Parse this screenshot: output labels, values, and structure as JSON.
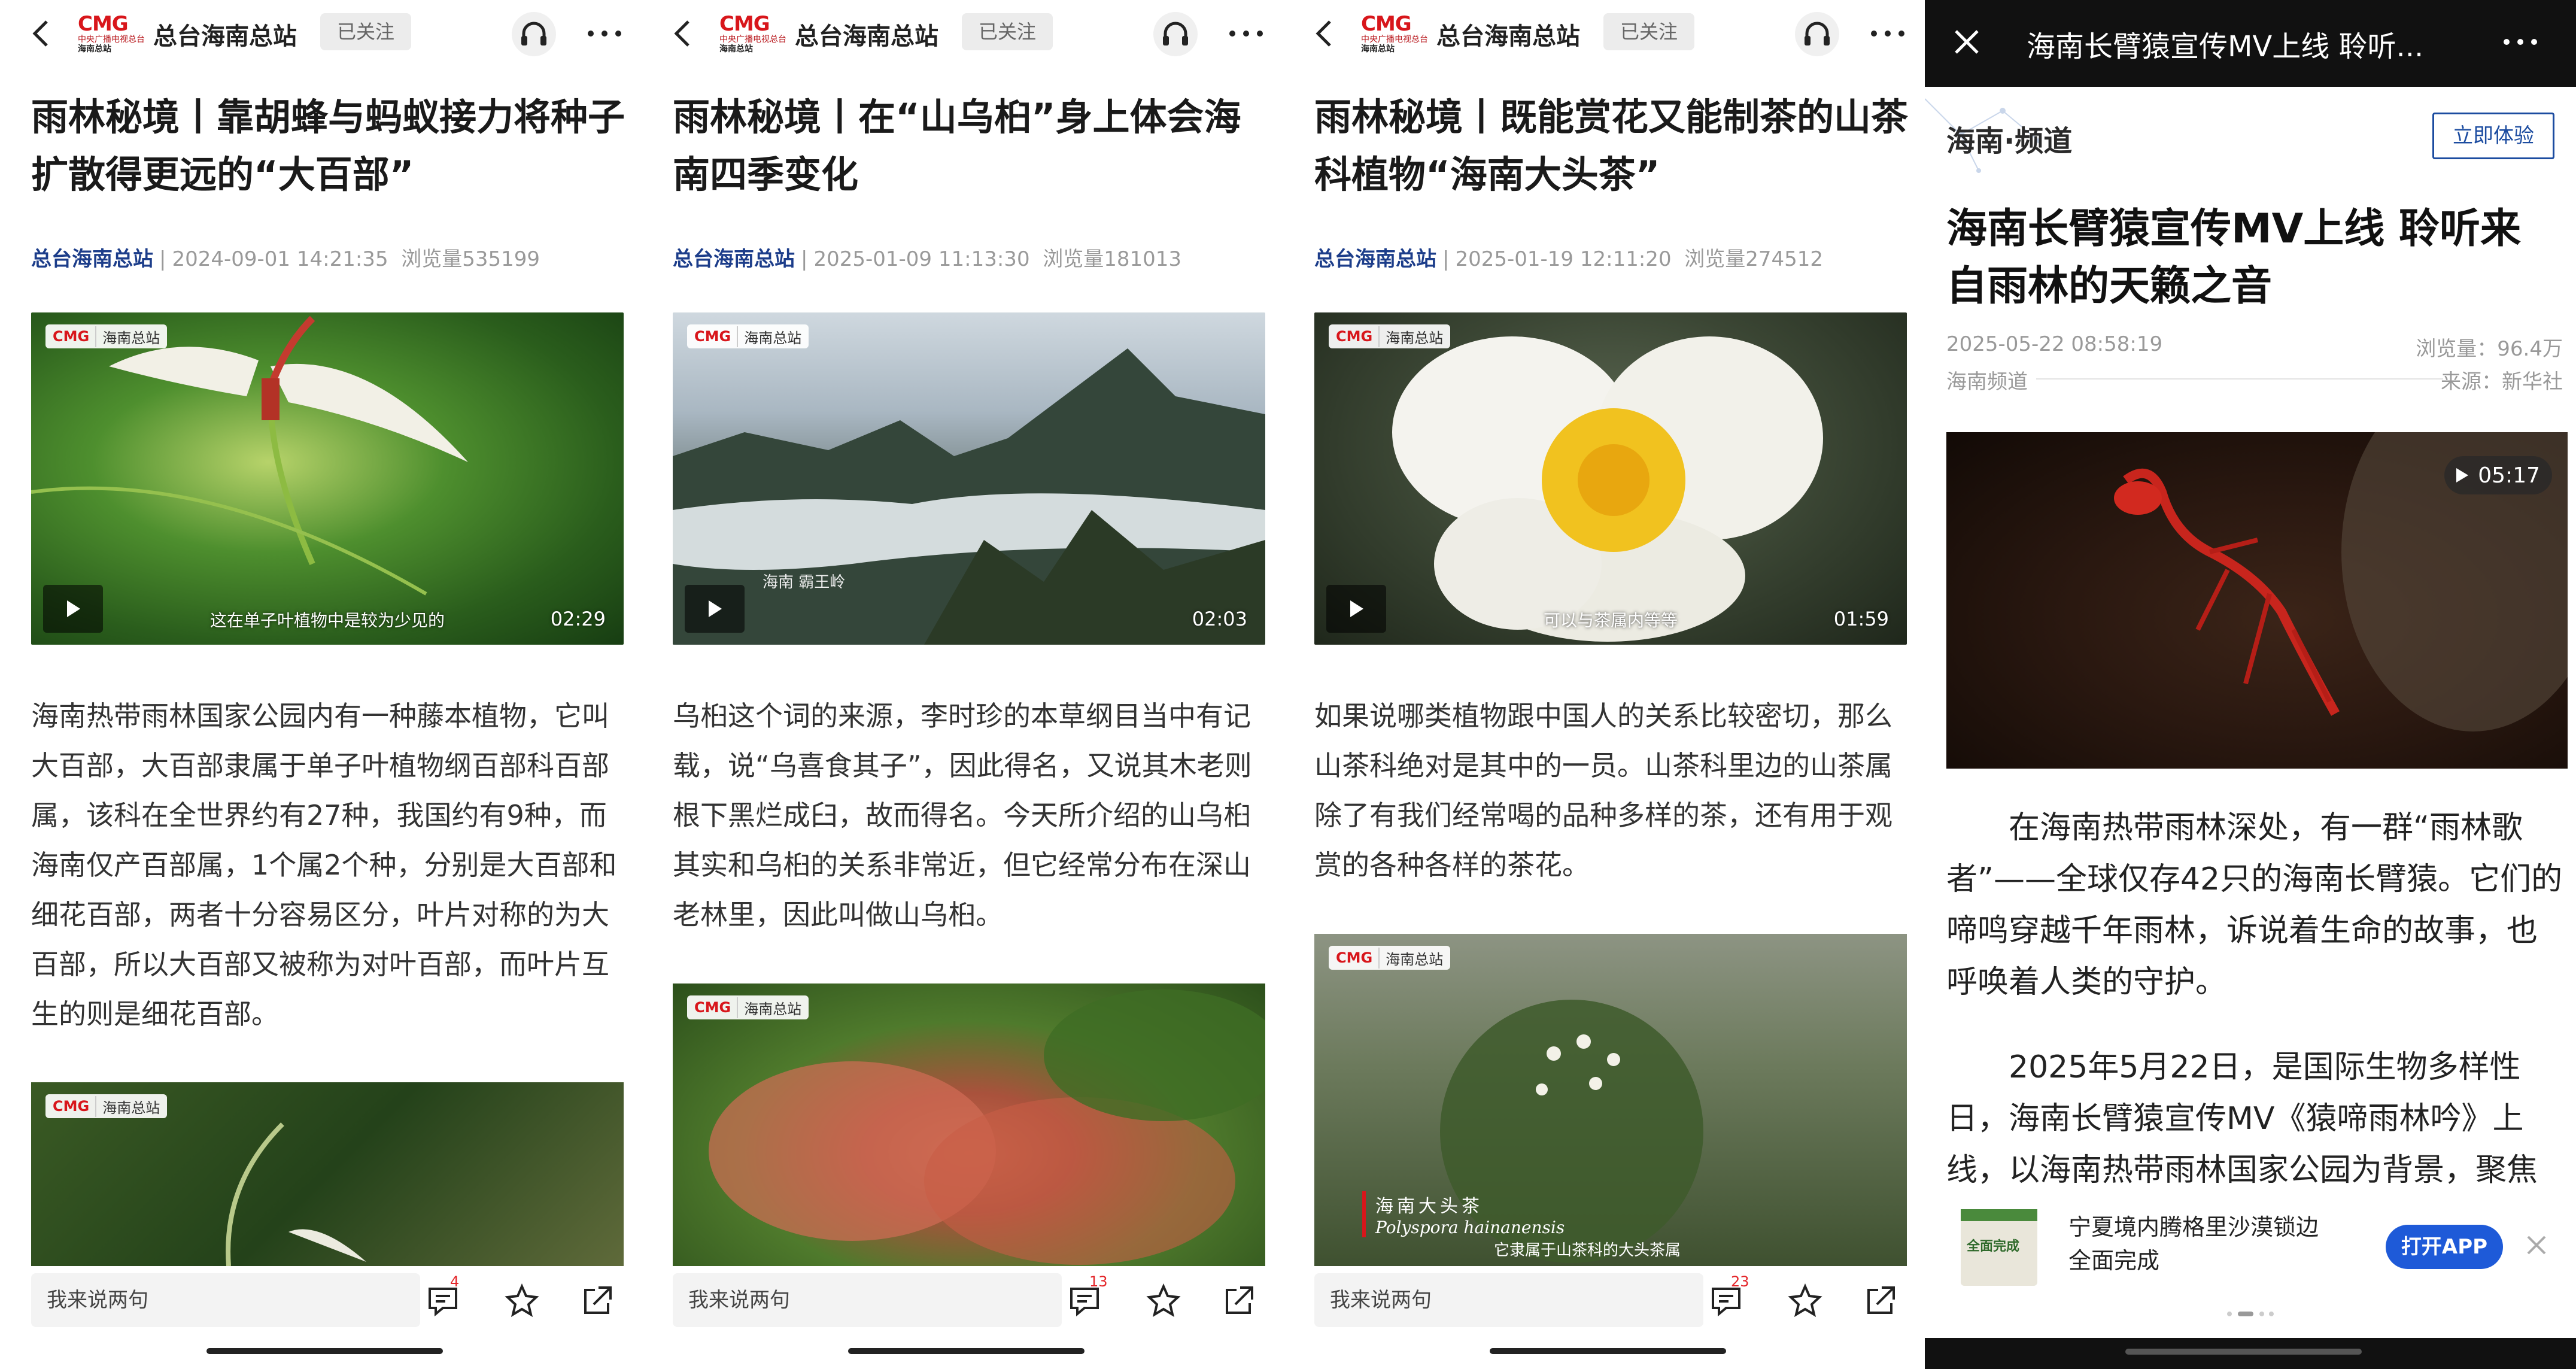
{
  "common": {
    "channel": "总台海南总站",
    "follow": "已关注",
    "comment_placeholder": "我来说两句",
    "tag_logo": "CMG",
    "tag_station": "海南总站",
    "logo_cmg": "CMG",
    "logo_line1": "中央广播电视总台",
    "logo_line2": "海南总站"
  },
  "articles": [
    {
      "title": "雨林秘境丨靠胡蜂与蚂蚁接力将种子扩散得更远的“大百部”",
      "source": "总台海南总站",
      "datetime": "2024-09-01 14:21:35",
      "views": "浏览量535199",
      "video_duration": "02:29",
      "video_subtitle": "这在单子叶植物中是较为少见的",
      "body": "海南热带雨林国家公园内有一种藤本植物，它叫大百部，大百部隶属于单子叶植物纲百部科百部属，该科在全世界约有27种，我国约有9种，而海南仅产百部属，1个属2个种，分别是大百部和细花百部，两者十分容易区分，叶片对称的为大百部，所以大百部又被称为对叶百部，而叶片互生的则是细花百部。",
      "comment_count": "4"
    },
    {
      "title": "雨林秘境丨在“山乌桕”身上体会海南四季变化",
      "source": "总台海南总站",
      "datetime": "2025-01-09 11:13:30",
      "views": "浏览量181013",
      "video_duration": "02:03",
      "video_location": "海南 霸王岭",
      "body": "乌桕这个词的来源，李时珍的本草纲目当中有记载，说“乌喜食其子”，因此得名，又说其木老则根下黑烂成臼，故而得名。今天所介绍的山乌桕其实和乌桕的关系非常近，但它经常分布在深山老林里，因此叫做山乌桕。",
      "comment_count": "13"
    },
    {
      "title": "雨林秘境丨既能赏花又能制茶的山茶科植物“海南大头茶”",
      "source": "总台海南总站",
      "datetime": "2025-01-19 12:11:20",
      "views": "浏览量274512",
      "video_duration": "01:59",
      "video_subtitle": "可以与茶属内等等",
      "body": "如果说哪类植物跟中国人的关系比较密切，那么山茶科绝对是其中的一员。山茶科里边的山茶属除了有我们经常喝的品种多样的茶，还有用于观赏的各种各样的茶花。",
      "caption_cn": "海南大头茶",
      "caption_latin": "Polyspora hainanensis",
      "caption_sub": "它隶属于山茶科的大头茶属",
      "comment_count": "23"
    }
  ],
  "panel4": {
    "title": "海南长臂猿宣传MV上线 聆听...",
    "channel": "海南·频道",
    "try_button": "立即体验",
    "headline": "海南长臂猿宣传MV上线 聆听来自雨林的天籁之音",
    "date": "2025-05-22 08:58:19",
    "views": "浏览量：96.4万",
    "source_channel": "海南频道",
    "source": "来源：新华社",
    "video_duration": "05:17",
    "para1": "在海南热带雨林深处，有一群“雨林歌者”——全球仅存42只的海南长臂猿。它们的啼鸣穿越千年雨林，诉说着生命的故事，也呼唤着人类的守护。",
    "para2": "2025年5月22日，是国际生物多样性日，海南长臂猿宣传MV《猿啼雨林吟》上线，以海南热带雨林国家公园为背景，聚焦",
    "ad_text": "宁夏境内腾格里沙漠锁边全面完成",
    "ad_image_text": "全面完成",
    "open_app": "打开APP"
  },
  "colors": {
    "cmg_red": "#d8161b",
    "source_blue": "#1c3d8a",
    "badge_red": "#e4262a",
    "app_blue": "#1e5ad8"
  }
}
